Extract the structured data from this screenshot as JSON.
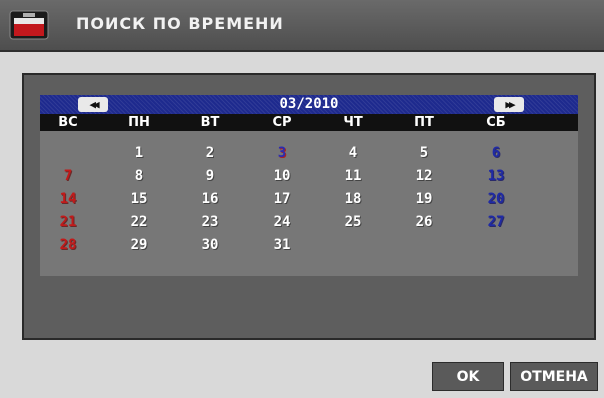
{
  "dialog": {
    "title": "ПОИСК ПО ВРЕМЕНИ",
    "icon": "monitor-icon"
  },
  "calendar": {
    "month_label": "03/2010",
    "prev_icon": "double-left-arrow-icon",
    "next_icon": "double-right-arrow-icon",
    "weekdays": [
      "ВС",
      "ПН",
      "ВТ",
      "СР",
      "ЧТ",
      "ПТ",
      "СБ"
    ],
    "selected_day": "3",
    "weeks": [
      [
        "",
        "1",
        "2",
        "3",
        "4",
        "5",
        "6"
      ],
      [
        "7",
        "8",
        "9",
        "10",
        "11",
        "12",
        "13"
      ],
      [
        "14",
        "15",
        "16",
        "17",
        "18",
        "19",
        "20"
      ],
      [
        "21",
        "22",
        "23",
        "24",
        "25",
        "26",
        "27"
      ],
      [
        "28",
        "29",
        "30",
        "31",
        "",
        "",
        ""
      ]
    ],
    "colors": {
      "sunday": "#c21a1a",
      "saturday": "#1f2aa6",
      "header": "#1e2a8e"
    }
  },
  "buttons": {
    "ok_label": "OK",
    "cancel_label": "ОТМЕНА"
  }
}
